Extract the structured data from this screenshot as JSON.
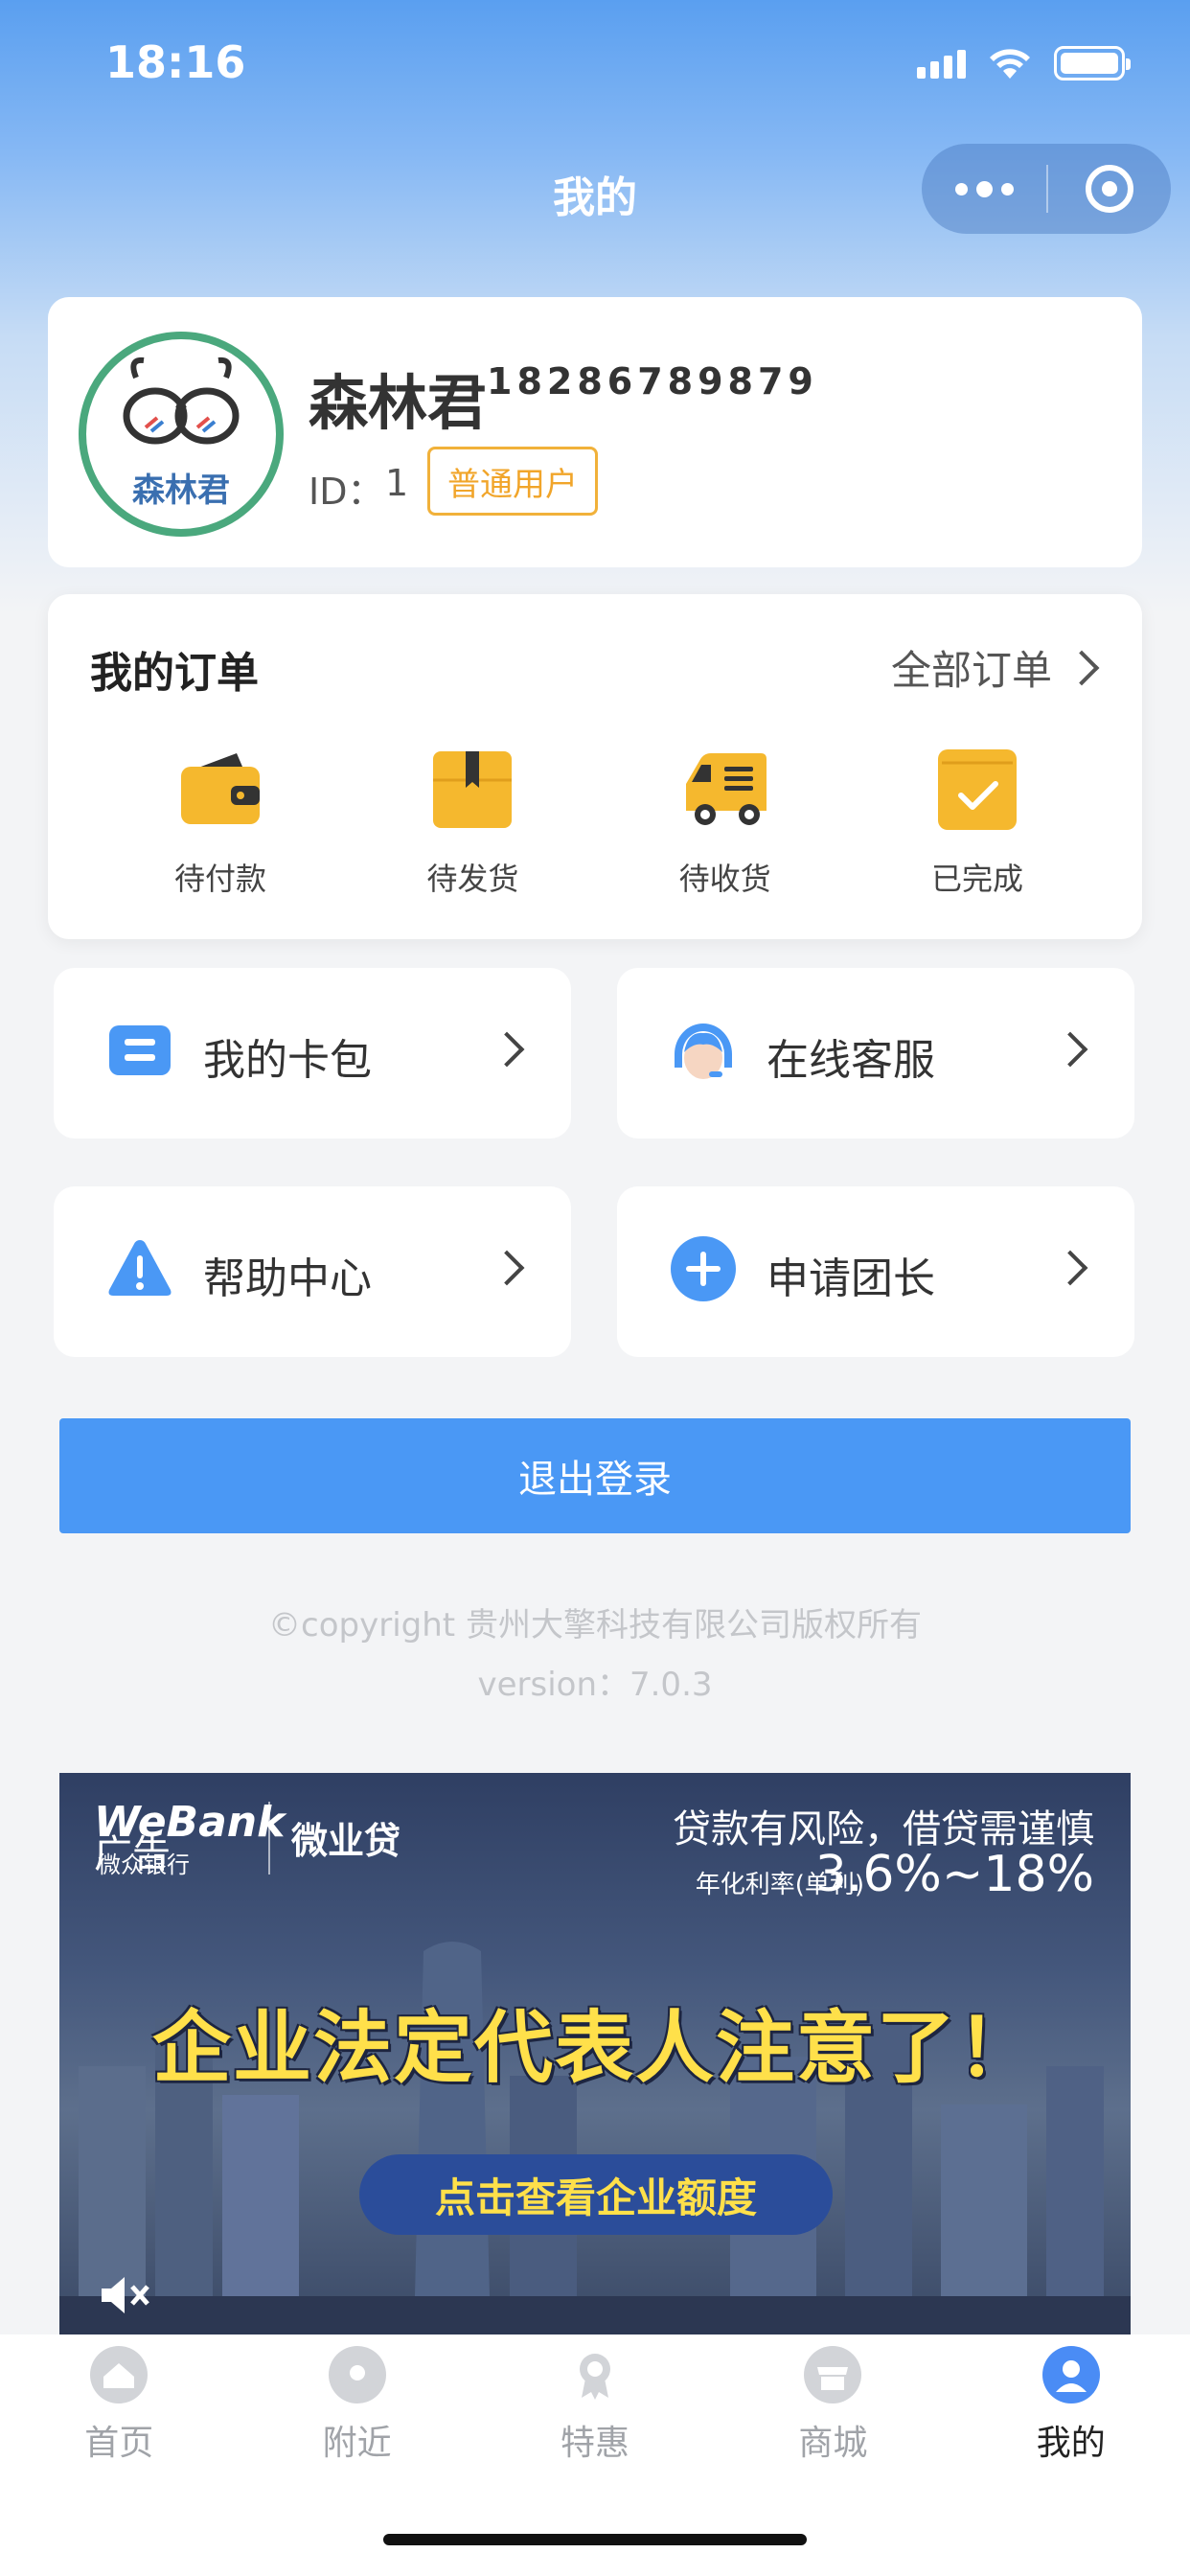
{
  "status_bar": {
    "time": "18:16"
  },
  "nav": {
    "title": "我的"
  },
  "profile": {
    "name": "森林君",
    "phone": "18286789879",
    "id_label": "ID：",
    "id_value": "1",
    "badge": "普通用户",
    "avatar_text": "森林君"
  },
  "orders": {
    "title": "我的订单",
    "all_label": "全部订单",
    "items": [
      {
        "label": "待付款",
        "icon": "wallet-icon"
      },
      {
        "label": "待发货",
        "icon": "package-icon"
      },
      {
        "label": "待收货",
        "icon": "truck-icon"
      },
      {
        "label": "已完成",
        "icon": "check-box-icon"
      }
    ]
  },
  "menu": [
    {
      "label": "我的卡包",
      "icon": "card-wallet-icon"
    },
    {
      "label": "在线客服",
      "icon": "customer-service-icon"
    },
    {
      "label": "帮助中心",
      "icon": "warning-icon"
    },
    {
      "label": "申请团长",
      "icon": "plus-circle-icon"
    }
  ],
  "logout_label": "退出登录",
  "footer": {
    "copyright": "©copyright 贵州大擎科技有限公司版权所有",
    "version": "version：7.0.3"
  },
  "ad": {
    "tag": "广告",
    "brand": "WeBank",
    "brand_sub": "微众银行",
    "product": "微业贷",
    "warning": "贷款有风险，借贷需谨慎",
    "rate_label": "年化利率(单利)",
    "rate": "3.6%~18%",
    "headline": "企业法定代表人注意了！",
    "cta": "点击查看企业额度"
  },
  "tabs": [
    {
      "label": "首页",
      "icon": "home-icon",
      "active": false
    },
    {
      "label": "附近",
      "icon": "location-icon",
      "active": false
    },
    {
      "label": "特惠",
      "icon": "medal-icon",
      "active": false
    },
    {
      "label": "商城",
      "icon": "shop-icon",
      "active": false
    },
    {
      "label": "我的",
      "icon": "user-icon",
      "active": true
    }
  ],
  "colors": {
    "primary": "#4a98f5",
    "accent_yellow": "#f5b82e",
    "badge_orange": "#f1a52a",
    "avatar_ring": "#4aa87d"
  }
}
